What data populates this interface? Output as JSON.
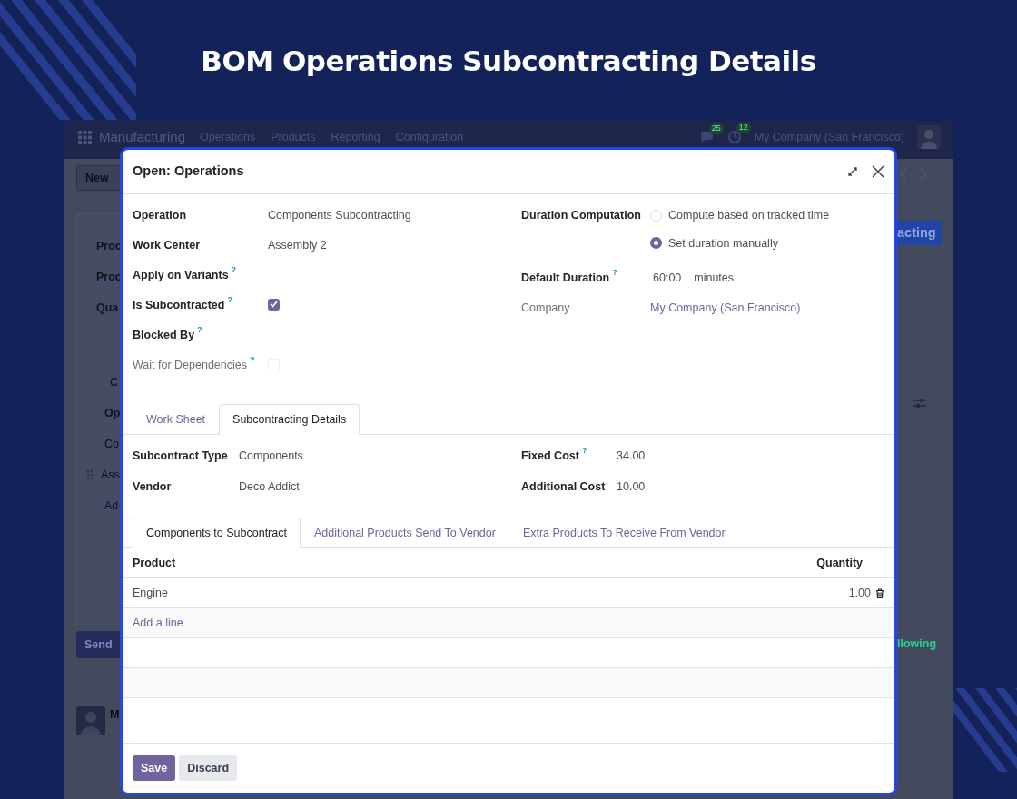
{
  "banner": {
    "title": "BOM Operations Subcontracting Details"
  },
  "app": {
    "brand": "Manufacturing",
    "menu": [
      "Operations",
      "Products",
      "Reporting",
      "Configuration"
    ],
    "messages_badge": "25",
    "activities_badge": "12",
    "company": "My Company (San Francisco)"
  },
  "background_form": {
    "new_button": "New",
    "left_fragments": [
      {
        "kind": "label",
        "text": "Proc"
      },
      {
        "kind": "label",
        "text": "Proc"
      },
      {
        "kind": "label",
        "text": "Qua"
      },
      {
        "kind": "cost",
        "text": "C"
      },
      {
        "kind": "header",
        "text": "Op"
      },
      {
        "kind": "cell",
        "text": "Co"
      },
      {
        "kind": "handle",
        "text": "Ass"
      },
      {
        "kind": "link",
        "text": "Ad"
      }
    ],
    "send_button": "Send",
    "author": "M",
    "status_badge": "acting",
    "follow_status": "llowing"
  },
  "dialog": {
    "title": "Open: Operations",
    "left_fields": [
      {
        "kind": "text",
        "label": "Operation",
        "value": "Components Subcontracting",
        "readonly": false
      },
      {
        "kind": "text",
        "label": "Work Center",
        "value": "Assembly 2",
        "readonly": false
      },
      {
        "kind": "text",
        "label": "Apply on Variants",
        "help": "?",
        "readonly": false
      },
      {
        "kind": "checkbox",
        "label": "Is Subcontracted",
        "help": "?",
        "checked": true,
        "readonly": false
      },
      {
        "kind": "text",
        "label": "Blocked By",
        "help": "?",
        "readonly": false
      },
      {
        "kind": "checkbox",
        "label": "Wait for Dependencies",
        "help": "?",
        "checked": false,
        "readonly": true
      }
    ],
    "right_fields": [
      {
        "kind": "radio",
        "label": "Duration Computation",
        "readonly": false,
        "options": [
          {
            "label": "Compute based on tracked time",
            "selected": false
          },
          {
            "label": "Set duration manually",
            "selected": true
          }
        ]
      },
      {
        "kind": "duration",
        "label": "Default Duration",
        "help": "?",
        "value": "60:00",
        "unit": "minutes",
        "readonly": false
      },
      {
        "kind": "link",
        "label": "Company",
        "value": "My Company (San Francisco)",
        "readonly": true
      }
    ],
    "tabs": [
      {
        "label": "Work Sheet",
        "selected": false
      },
      {
        "label": "Subcontracting Details",
        "selected": true
      }
    ],
    "subcontract_left": [
      {
        "label": "Subcontract Type",
        "value": "Components"
      },
      {
        "label": "Vendor",
        "value": "Deco Addict"
      }
    ],
    "subcontract_right": [
      {
        "label": "Fixed Cost",
        "help": "?",
        "value": "34.00"
      },
      {
        "label": "Additional Cost",
        "value": "10.00"
      }
    ],
    "inner_tabs": [
      {
        "label": "Components to Subcontract",
        "selected": true
      },
      {
        "label": "Additional Products Send To Vendor",
        "selected": false
      },
      {
        "label": "Extra Products To Receive From Vendor",
        "selected": false
      }
    ],
    "table": {
      "columns": [
        "Product",
        "Quantity"
      ],
      "rows": [
        {
          "product": "Engine",
          "quantity": "1.00"
        }
      ],
      "add_line": "Add a line"
    },
    "buttons": [
      {
        "label": "Save",
        "kind": "primary"
      },
      {
        "label": "Discard",
        "kind": "secondary"
      }
    ]
  }
}
